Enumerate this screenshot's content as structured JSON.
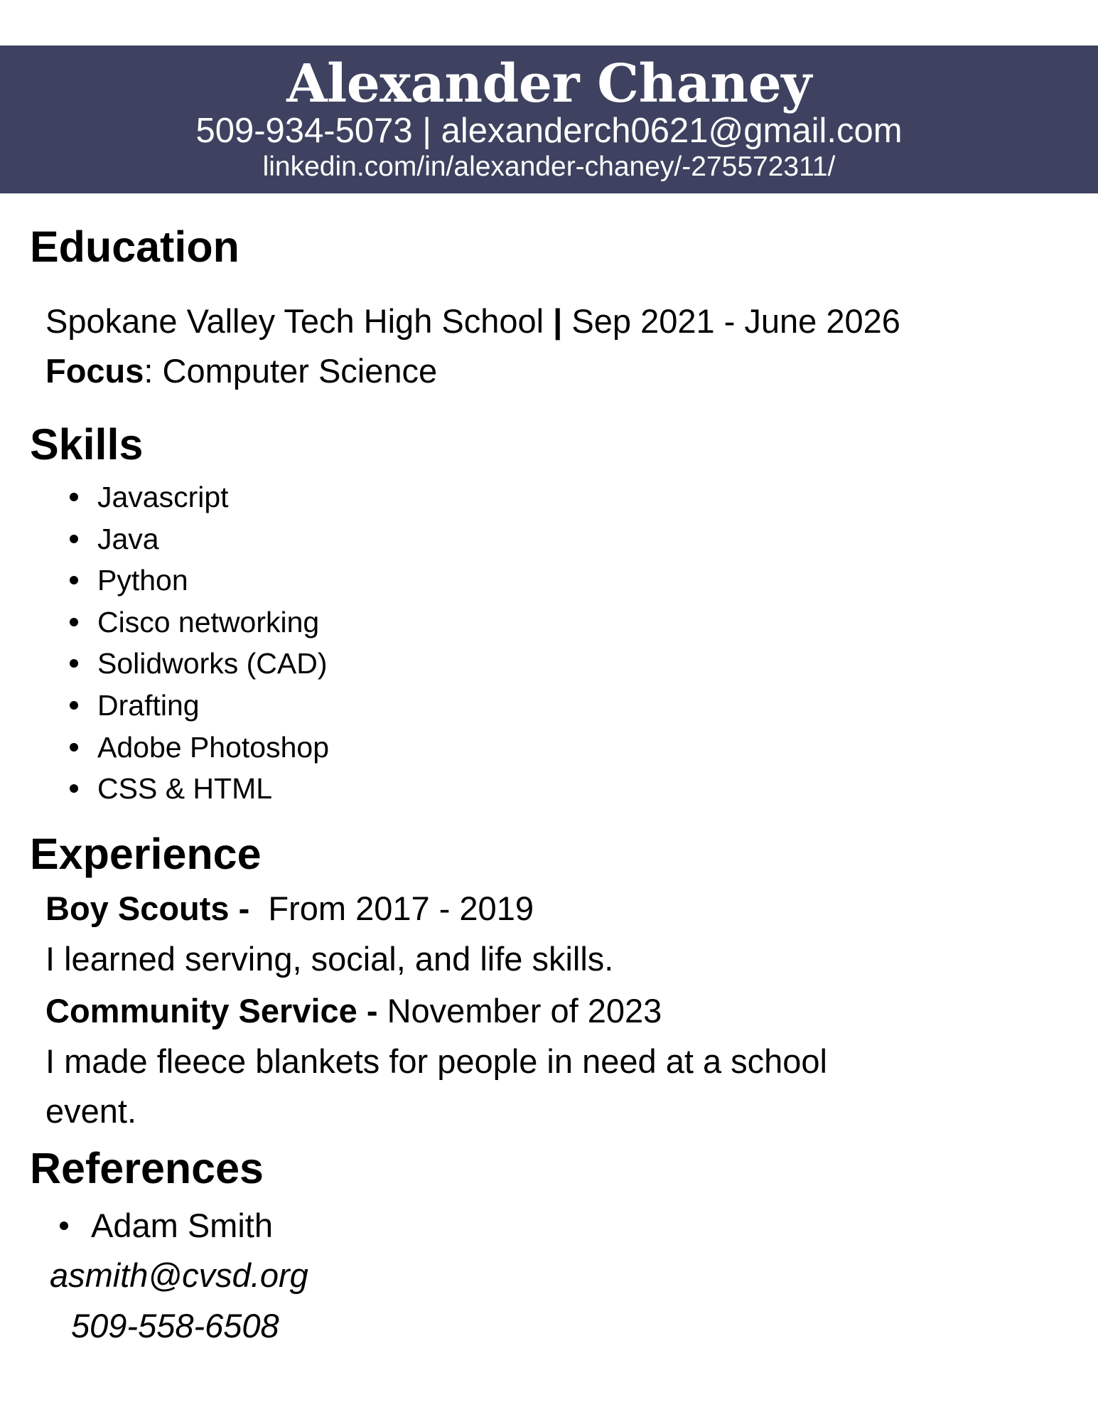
{
  "header": {
    "name": "Alexander Chaney",
    "phone": "509-934-5073",
    "separator": " | ",
    "email": "alexanderch0621@gmail.com",
    "linkedin": "linkedin.com/in/alexander-chaney/-275572311/",
    "band_color": "#3e4260"
  },
  "education": {
    "title": "Education",
    "school": "Spokane Valley Tech High School",
    "separator": " | ",
    "dates": "Sep 2021 - June 2026",
    "focus_label": "Focus",
    "focus_value": ": Computer Science"
  },
  "skills": {
    "title": "Skills",
    "items": [
      "Javascript",
      "Java",
      "Python",
      "Cisco networking",
      "Solidworks (CAD)",
      "Drafting",
      "Adobe Photoshop",
      "CSS & HTML"
    ]
  },
  "experience": {
    "title": "Experience",
    "entries": [
      {
        "role": "Boy Scouts - ",
        "period": " From 2017 - 2019",
        "description": "I learned serving, social, and life skills."
      },
      {
        "role": "Community Service - ",
        "period": "November of 2023",
        "description_line1": "I made fleece blankets for people in need at a school",
        "description_line2": "event."
      }
    ]
  },
  "references": {
    "title": "References",
    "people": [
      {
        "name": "Adam Smith",
        "email": "asmith@cvsd.org",
        "phone": "509-558-6508"
      }
    ]
  }
}
